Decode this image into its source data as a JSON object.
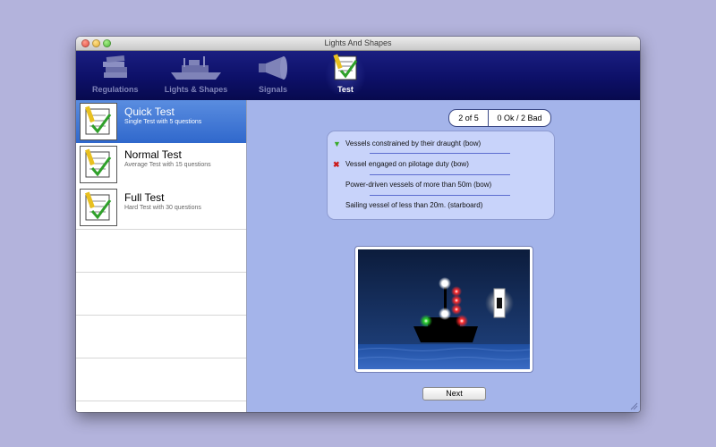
{
  "window": {
    "title": "Lights And Shapes"
  },
  "toolbar": {
    "items": [
      {
        "label": "Regulations",
        "icon": "books-icon",
        "active": false
      },
      {
        "label": "Lights & Shapes",
        "icon": "ship-icon",
        "active": false
      },
      {
        "label": "Signals",
        "icon": "horn-icon",
        "active": false
      },
      {
        "label": "Test",
        "icon": "checklist-icon",
        "active": true
      }
    ]
  },
  "sidebar": {
    "items": [
      {
        "title": "Quick Test",
        "subtitle": "Single Test with 5 questions",
        "selected": true
      },
      {
        "title": "Normal Test",
        "subtitle": "Average Test with 15 questions",
        "selected": false
      },
      {
        "title": "Full Test",
        "subtitle": "Hard Test with 30 questions",
        "selected": false
      }
    ]
  },
  "test": {
    "progress": "2 of 5",
    "score": "0 Ok / 2 Bad",
    "answers": [
      {
        "text": "Vessels constrained by their draught (bow)",
        "status": "ok"
      },
      {
        "text": "Vessel engaged on pilotage duty (bow)",
        "status": "bad"
      },
      {
        "text": "Power-driven vessels of more than 50m (bow)",
        "status": "none"
      },
      {
        "text": "Sailing vessel of less than 20m. (starboard)",
        "status": "none"
      }
    ],
    "next_label": "Next"
  },
  "colors": {
    "toolbar": "#0d1068",
    "selection": "#3068cc",
    "content_bg": "#a4b4ea",
    "answers_bg": "#c8d3fa",
    "ok_mark": "#3aaa2a",
    "bad_mark": "#cc1a1a"
  }
}
